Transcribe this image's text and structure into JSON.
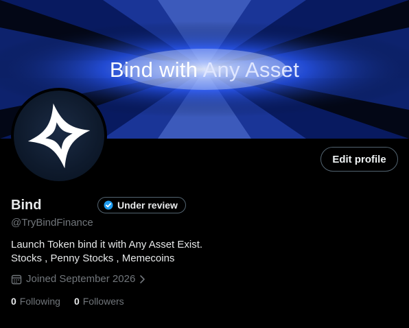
{
  "banner": {
    "text_part1": "Bind with",
    "text_part2": "Any Asset"
  },
  "profile": {
    "name": "Bind",
    "handle": "@TryBindFinance",
    "badge_label": "Under review",
    "bio_line1": "Launch Token bind it with Any Asset Exist.",
    "bio_line2": "Stocks , Penny Stocks , Memecoins",
    "joined": "Joined September 2026"
  },
  "actions": {
    "edit_profile_label": "Edit profile"
  },
  "stats": {
    "following_count": "0",
    "following_label": "Following",
    "followers_count": "0",
    "followers_label": "Followers"
  },
  "icons": {
    "badge": "verified-check-icon",
    "joined": "calendar-icon",
    "chevron": "chevron-right-icon",
    "avatar_logo": "four-point-star-logo"
  },
  "colors": {
    "background": "#000000",
    "text_primary": "#e7e9ea",
    "text_secondary": "#71767b",
    "border": "#536471",
    "verified_blue": "#1d9bf0",
    "banner_glow": "#2a5bff"
  }
}
